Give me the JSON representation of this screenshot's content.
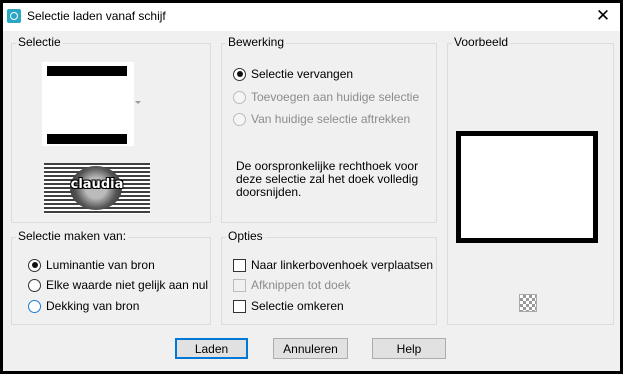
{
  "window": {
    "title": "Selectie laden vanaf schijf",
    "close_glyph": "✕"
  },
  "selectie_group": {
    "label": "Selectie",
    "logo_text": "claudia"
  },
  "bewerking_group": {
    "label": "Bewerking",
    "options": [
      {
        "label": "Selectie vervangen",
        "selected": true,
        "enabled": true
      },
      {
        "label": "Toevoegen aan huidige selectie",
        "selected": false,
        "enabled": false
      },
      {
        "label": "Van huidige selectie aftrekken",
        "selected": false,
        "enabled": false
      }
    ],
    "info": "De oorspronkelijke rechthoek voor deze selectie zal het doek volledig doorsnijden."
  },
  "voorbeeld_group": {
    "label": "Voorbeeld"
  },
  "selectie_maken_group": {
    "label": "Selectie maken van:",
    "options": [
      {
        "label": "Luminantie van bron",
        "selected": true
      },
      {
        "label": "Elke waarde niet gelijk aan nul",
        "selected": false
      },
      {
        "label": "Dekking van bron",
        "selected": false
      }
    ]
  },
  "opties_group": {
    "label": "Opties",
    "options": [
      {
        "label": "Naar linkerbovenhoek verplaatsen",
        "checked": false,
        "enabled": true
      },
      {
        "label": "Afknippen tot doek",
        "checked": false,
        "enabled": false
      },
      {
        "label": "Selectie omkeren",
        "checked": false,
        "enabled": true
      }
    ]
  },
  "buttons": {
    "load": "Laden",
    "cancel": "Annuleren",
    "help": "Help"
  },
  "colors": {
    "accent": "#0078d7",
    "dialog_bg": "#f0f0f0"
  }
}
